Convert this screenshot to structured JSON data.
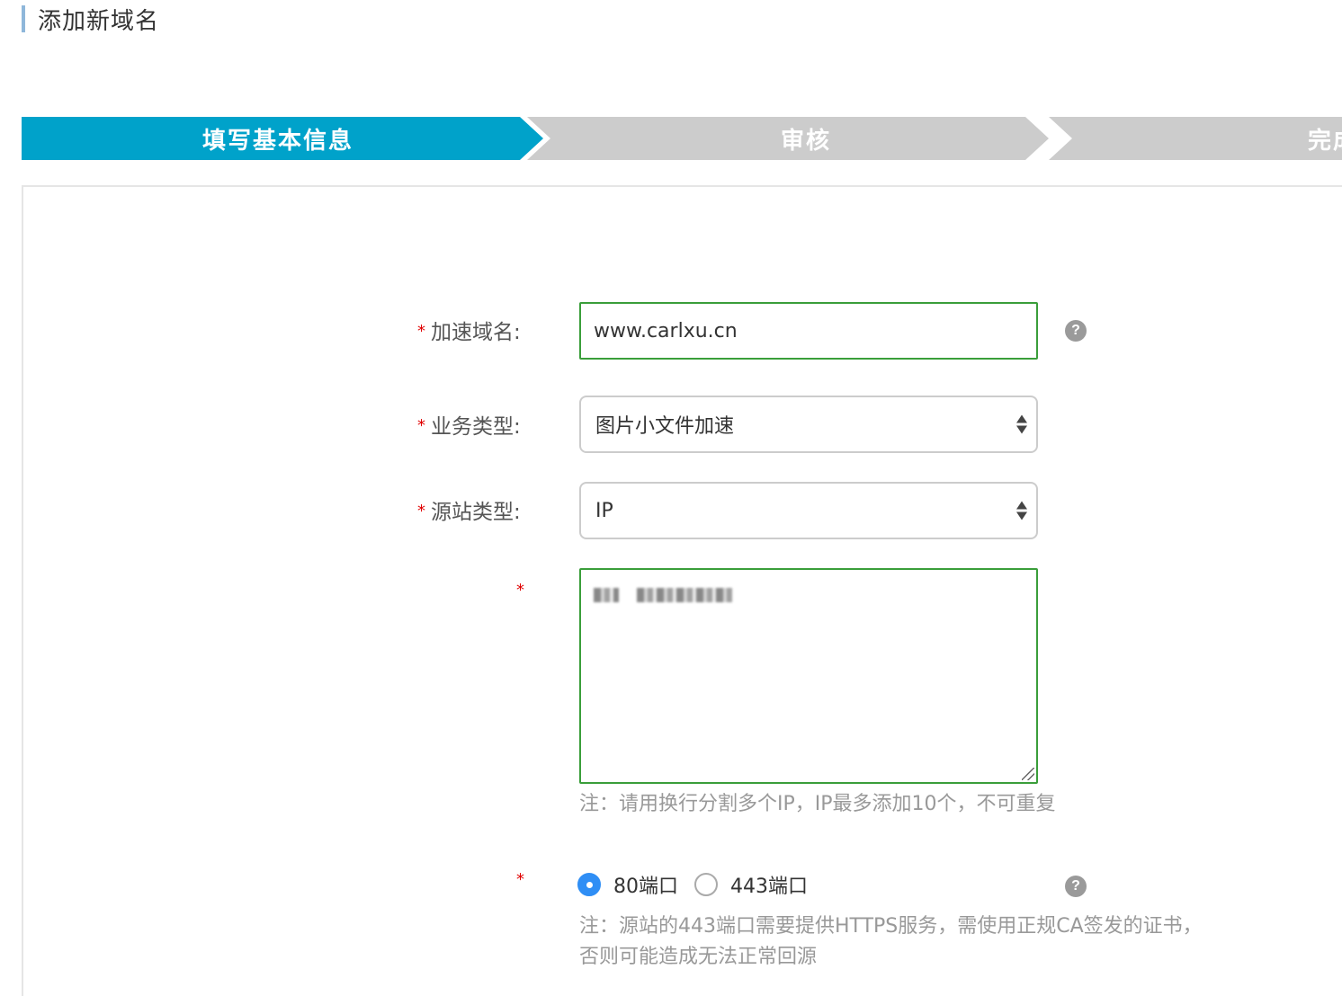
{
  "page": {
    "title": "添加新域名"
  },
  "steps": [
    {
      "label": "填写基本信息",
      "active": true
    },
    {
      "label": "审核",
      "active": false
    },
    {
      "label": "完成",
      "active": false
    }
  ],
  "form": {
    "required_mark": "*",
    "domain": {
      "label": "加速域名:",
      "value": "www.carlxu.cn"
    },
    "business_type": {
      "label": "业务类型:",
      "selected": "图片小文件加速"
    },
    "origin_type": {
      "label": "源站类型:",
      "selected": "IP"
    },
    "origin_ips": {
      "note": "注：请用换行分割多个IP，IP最多添加10个，不可重复"
    },
    "port": {
      "options": [
        {
          "label": "80端口",
          "checked": true
        },
        {
          "label": "443端口",
          "checked": false
        }
      ],
      "note_line1": "注：源站的443端口需要提供HTTPS服务，需使用正规CA签发的证书，",
      "note_line2": "否则可能造成无法正常回源"
    },
    "help_icon_text": "?"
  },
  "colors": {
    "step_active": "#00a2ca",
    "step_inactive": "#cccccc",
    "input_valid_border": "#3a9e3a",
    "required": "#e00000",
    "radio_checked": "#2f8ef5"
  }
}
